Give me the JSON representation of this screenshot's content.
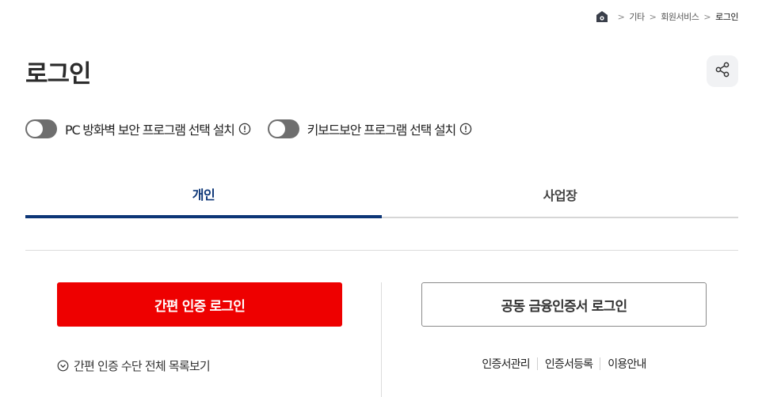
{
  "breadcrumb": {
    "items": [
      "기타",
      "회원서비스",
      "로그인"
    ]
  },
  "page": {
    "title": "로그인"
  },
  "toggles": [
    {
      "label": "PC 방화벽 보안 프로그램 선택 설치",
      "enabled": false
    },
    {
      "label": "키보드보안 프로그램 선택 설치",
      "enabled": false
    }
  ],
  "tabs": [
    {
      "label": "개인",
      "active": true
    },
    {
      "label": "사업장",
      "active": false
    }
  ],
  "login": {
    "easy_button": "간편 인증 로그인",
    "cert_button": "공동 금융인증서 로그인",
    "view_all": "간편 인증 수단 전체 목록보기"
  },
  "cert_links": [
    "인증서관리",
    "인증서등록",
    "이용안내"
  ],
  "colors": {
    "brand_red": "#ee0000",
    "tab_active": "#0d3677",
    "toggle_off": "#6e6e6e"
  }
}
